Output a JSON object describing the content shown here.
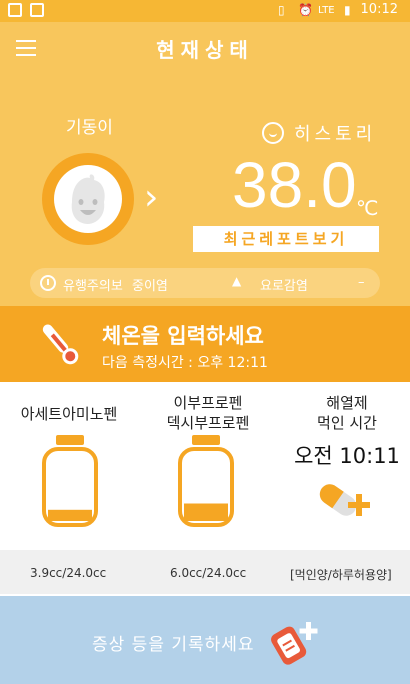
{
  "status_bar": {
    "time": "10:12",
    "lte": "LTE"
  },
  "app_bar": {
    "title": "현재상태"
  },
  "child": {
    "name": "기동이"
  },
  "history": {
    "label": "히스토리"
  },
  "temperature": {
    "value": "38.0",
    "unit": "℃"
  },
  "report_button": {
    "label": "최근레포트보기"
  },
  "alerts": {
    "flu_label": "유행주의보",
    "flu_status": "중이염",
    "uti_label": "요로감염",
    "uti_status": "–"
  },
  "input_banner": {
    "title": "체온을 입력하세요",
    "next_measure": "다음 측정시간 : 오후 12:11"
  },
  "medicines": [
    {
      "name": "아세트아미노펜",
      "dose": "3.9cc/24.0cc",
      "level": 0.16
    },
    {
      "name_line1": "이부프로펜",
      "name_line2": "덱시부프로펜",
      "dose": "6.0cc/24.0cc",
      "level": 0.25
    }
  ],
  "antipyretic": {
    "label_line1": "해열제",
    "label_line2": "먹인 시간",
    "time": "오전 10:11",
    "dose_legend": "[먹인양/하루허용양]"
  },
  "symptom": {
    "label": "증상 등을 기록하세요"
  },
  "colors": {
    "header": "#F8C65C",
    "accent": "#F5A623",
    "symptom_bg": "#B3D1E9"
  }
}
